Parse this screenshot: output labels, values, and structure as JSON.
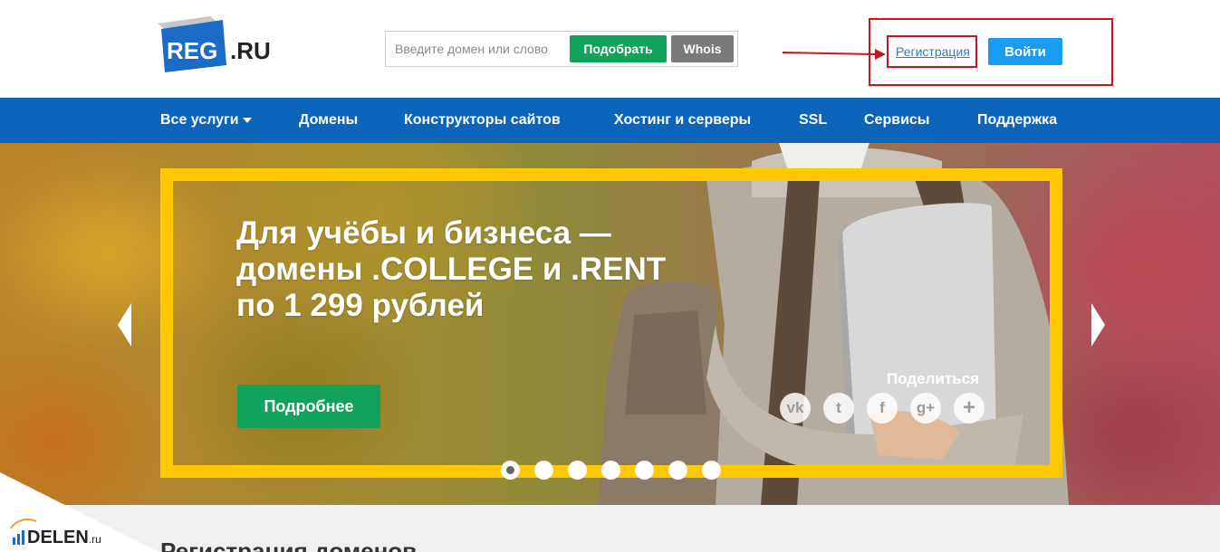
{
  "header": {
    "logo_reg": "REG",
    "logo_ru": ".RU",
    "search_placeholder": "Введите домен или слово",
    "pick_label": "Подобрать",
    "whois_label": "Whois",
    "register_link": "Регистрация",
    "login_label": "Войти"
  },
  "nav": {
    "items": [
      {
        "label": "Все услуги"
      },
      {
        "label": "Домены"
      },
      {
        "label": "Конструкторы сайтов"
      },
      {
        "label": "Хостинг и серверы"
      },
      {
        "label": "SSL"
      },
      {
        "label": "Сервисы"
      },
      {
        "label": "Поддержка"
      }
    ]
  },
  "banner": {
    "headline": [
      "Для учёбы и бизнеса —",
      "домены .COLLEGE и .RENT",
      "по 1 299 рублей"
    ],
    "more_label": "Подробнее",
    "share_label": "Поделиться",
    "share_icons": [
      {
        "name": "vk-icon",
        "glyph": "vk"
      },
      {
        "name": "twitter-icon",
        "glyph": "t"
      },
      {
        "name": "facebook-icon",
        "glyph": "f"
      },
      {
        "name": "google-plus-icon",
        "glyph": "g+"
      },
      {
        "name": "more-share-icon",
        "glyph": "+"
      }
    ],
    "slide_count": 7,
    "active_slide": 1
  },
  "section": {
    "title": "Регистрация доменов"
  },
  "watermark": {
    "text": "DELEN",
    "suffix": ".ru"
  },
  "colors": {
    "nav_bg": "#0c64bb",
    "green": "#12a35a",
    "login_blue": "#1a9cf2",
    "frame_yellow": "#ffc800",
    "annotation_red": "#c8141c"
  }
}
